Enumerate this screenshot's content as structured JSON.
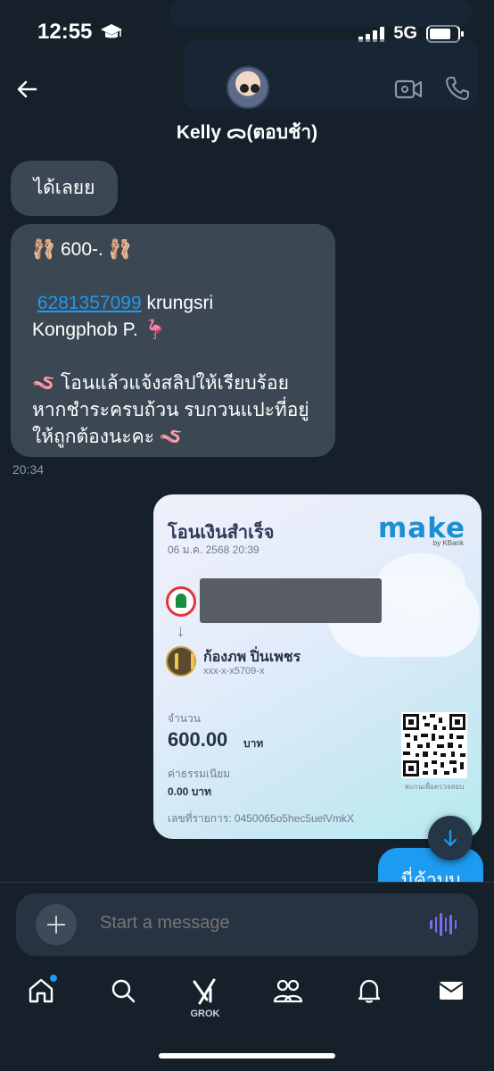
{
  "status_bar": {
    "time": "12:55",
    "network": "5G",
    "battery_level": 0.75
  },
  "header": {
    "contact_name": "Kelly ᯅ(ตอบช้า)"
  },
  "messages": {
    "msg1": "ได้เลยย",
    "msg2": {
      "line1": "🩰 600-. 🩰",
      "account_number": "6281357099",
      "bank": " krungsri",
      "line3": "Kongphob P. 🦩",
      "line5": "🪱 โอนแล้วแจ้งสลิปให้เรียบร้อย",
      "line6": "หากชำระครบถ้วน รบกวนแปะที่อยู่",
      "line7": "ให้ถูกต้องนะคะ 🪱"
    },
    "timestamp": "20:34",
    "outgoing_partial": "นี่ค้าบบ"
  },
  "receipt": {
    "title": "โอนเงินสำเร็จ",
    "date": "06 ม.ค. 2568 20:39",
    "logo": "make",
    "logo_sub": "by KBank",
    "recipient_name": "ก้องภพ ปิ่นเพชร",
    "recipient_account": "xxx-x-x5709-x",
    "amount_label": "จำนวน",
    "amount": "600.00",
    "amount_unit": "บาท",
    "fee_label": "ค่าธรรมเนียม",
    "fee": "0.00 บาท",
    "reference": "เลขที่รายการ: 0450065o5hec5uelVmkX",
    "qr_caption": "สแกนเพื่อตรวจสอบ"
  },
  "composer": {
    "placeholder": "Start a message"
  },
  "tabbar": {
    "grok_label": "GROK"
  },
  "colors": {
    "background": "#15202b",
    "accent": "#1d9bf0",
    "bubble": "#3b4753",
    "voice": "#7b6cf6"
  }
}
